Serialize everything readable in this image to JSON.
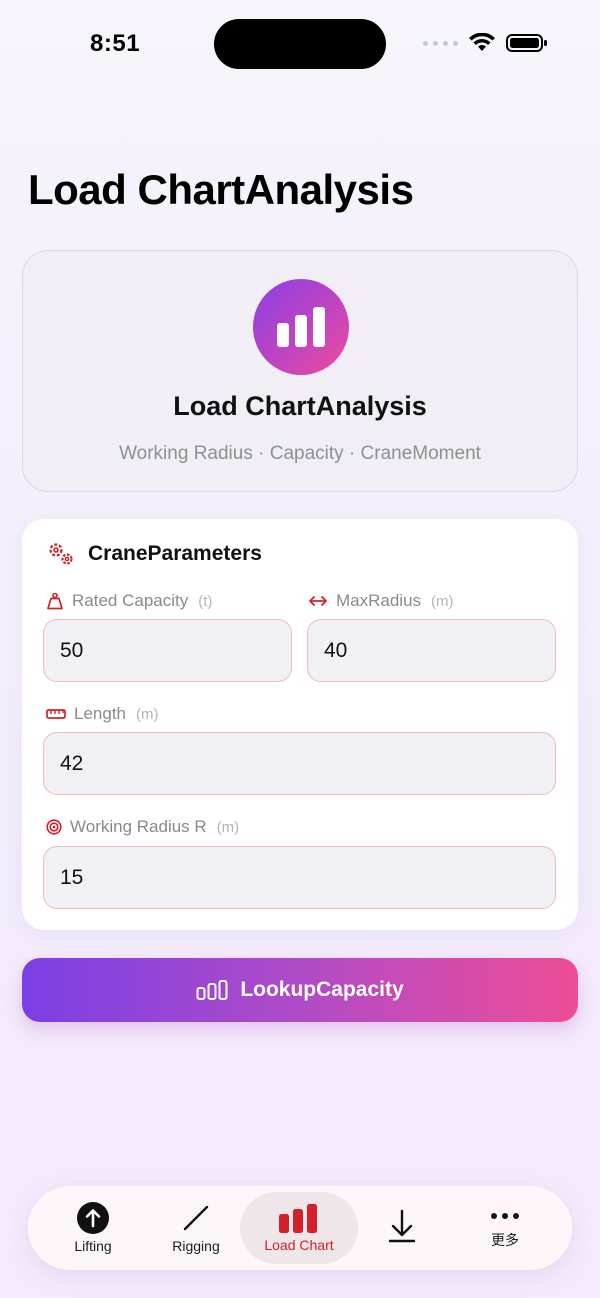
{
  "status": {
    "time": "8:51"
  },
  "page": {
    "title": "Load ChartAnalysis"
  },
  "hero": {
    "icon": "bar-chart-icon",
    "title": "Load ChartAnalysis",
    "subtitle": "Working Radius · Capacity · CraneMoment"
  },
  "params": {
    "title": "CraneParameters",
    "icon": "gears-icon",
    "fields": {
      "rated_capacity": {
        "label": "Rated Capacity",
        "unit": "(t)",
        "value": "50",
        "icon": "weight-icon"
      },
      "max_radius": {
        "label": "MaxRadius",
        "unit": "(m)",
        "value": "40",
        "icon": "left-right-arrow-icon"
      },
      "length": {
        "label": "Length",
        "unit": "(m)",
        "value": "42",
        "icon": "ruler-icon"
      },
      "working_radius": {
        "label": "Working Radius R",
        "unit": "(m)",
        "value": "15",
        "icon": "target-icon"
      }
    }
  },
  "action": {
    "lookup_label": "LookupCapacity",
    "icon": "bar-chart-icon"
  },
  "tabs": [
    {
      "label": "Lifting",
      "icon": "arrow-up-circle-icon",
      "active": false
    },
    {
      "label": "Rigging",
      "icon": "slash-line-icon",
      "active": false
    },
    {
      "label": "Load Chart",
      "icon": "bar-chart-icon",
      "active": true
    },
    {
      "label": "",
      "icon": "download-arrow-icon",
      "active": false
    },
    {
      "label": "更多",
      "icon": "more-dots-icon",
      "active": false
    }
  ],
  "colors": {
    "accent_purple": "#7b3fe4",
    "accent_pink": "#ee4c96",
    "active_tab_red": "#d1202a",
    "field_border": "#f1b8c2"
  }
}
